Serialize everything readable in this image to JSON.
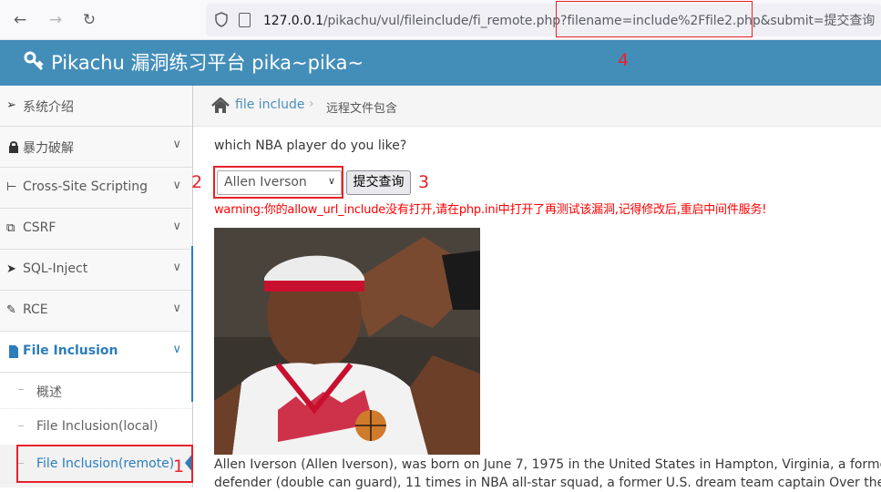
{
  "browser": {
    "url_host": "127.0.0.1",
    "url_rest": "/pikachu/vul/fileinclude/fi_remote.php?filename=include%2Ffile2.php&submit=提交查询"
  },
  "header": {
    "title": "Pikachu 漏洞练习平台 pika~pika~"
  },
  "sidebar": {
    "items": [
      {
        "label": "系统介绍",
        "icon": "tags-icon"
      },
      {
        "label": "暴力破解",
        "icon": "lock-icon"
      },
      {
        "label": "Cross-Site Scripting",
        "icon": "sitemap-icon"
      },
      {
        "label": "CSRF",
        "icon": "share-icon"
      },
      {
        "label": "SQL-Inject",
        "icon": "fighter-jet-icon"
      },
      {
        "label": "RCE",
        "icon": "pencil-icon"
      },
      {
        "label": "File Inclusion",
        "icon": "file-icon"
      }
    ],
    "subitems": [
      {
        "label": "概述"
      },
      {
        "label": "File Inclusion(local)"
      },
      {
        "label": "File Inclusion(remote)"
      }
    ]
  },
  "breadcrumb": {
    "link": "file include",
    "current": "远程文件包含"
  },
  "content": {
    "question": "which NBA player do you like?",
    "select_value": "Allen Iverson",
    "submit_label": "提交查询",
    "warning": "warning:你的allow_url_include没有打开,请在php.ini中打开了再测试该漏洞,记得修改后,重启中间件服务!",
    "bio_line1": "Allen Iverson (Allen Iverson), was born on June 7, 1975 in the United States in Hampton, Virginia, a former American professional basketball player,",
    "bio_line2": "defender (double can guard), 11 times in NBA all-star squad, a former U.S. dream team captain Over the years, he was"
  },
  "annotations": {
    "n1": "1",
    "n2": "2",
    "n3": "3",
    "n4": "4"
  },
  "colors": {
    "header_bg": "#438eb9",
    "accent": "#2b7dbc",
    "warning": "#ff0000",
    "annotation": "#e8212a"
  }
}
